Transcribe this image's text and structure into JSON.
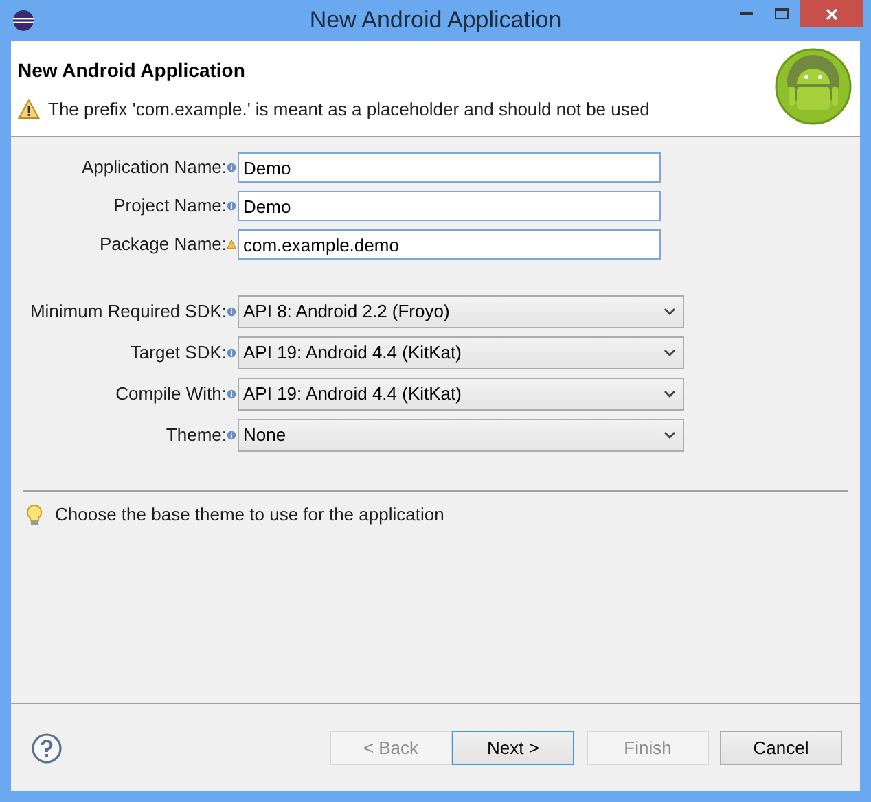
{
  "window": {
    "title": "New Android Application"
  },
  "header": {
    "title": "New Android Application",
    "message": "The prefix 'com.example.' is meant as a placeholder and should not be used"
  },
  "text_fields": [
    {
      "label": "Application Name:",
      "kind": "info",
      "value": "Demo"
    },
    {
      "label": "Project Name:",
      "kind": "info",
      "value": "Demo"
    },
    {
      "label": "Package Name:",
      "kind": "warning",
      "value": "com.example.demo"
    }
  ],
  "dropdowns": [
    {
      "label": "Minimum Required SDK:",
      "kind": "info",
      "value": "API 8: Android 2.2 (Froyo)"
    },
    {
      "label": "Target SDK:",
      "kind": "info",
      "value": "API 19: Android 4.4 (KitKat)"
    },
    {
      "label": "Compile With:",
      "kind": "info",
      "value": "API 19: Android 4.4 (KitKat)"
    },
    {
      "label": "Theme:",
      "kind": "info",
      "value": "None"
    }
  ],
  "hint": "Choose the base theme to use for the application",
  "buttons": [
    {
      "label": "< Back",
      "disabled": true,
      "focused": false
    },
    {
      "label": "Next >",
      "disabled": false,
      "focused": true
    },
    {
      "label": "Finish",
      "disabled": true,
      "focused": false
    },
    {
      "label": "Cancel",
      "disabled": false,
      "focused": false
    }
  ]
}
